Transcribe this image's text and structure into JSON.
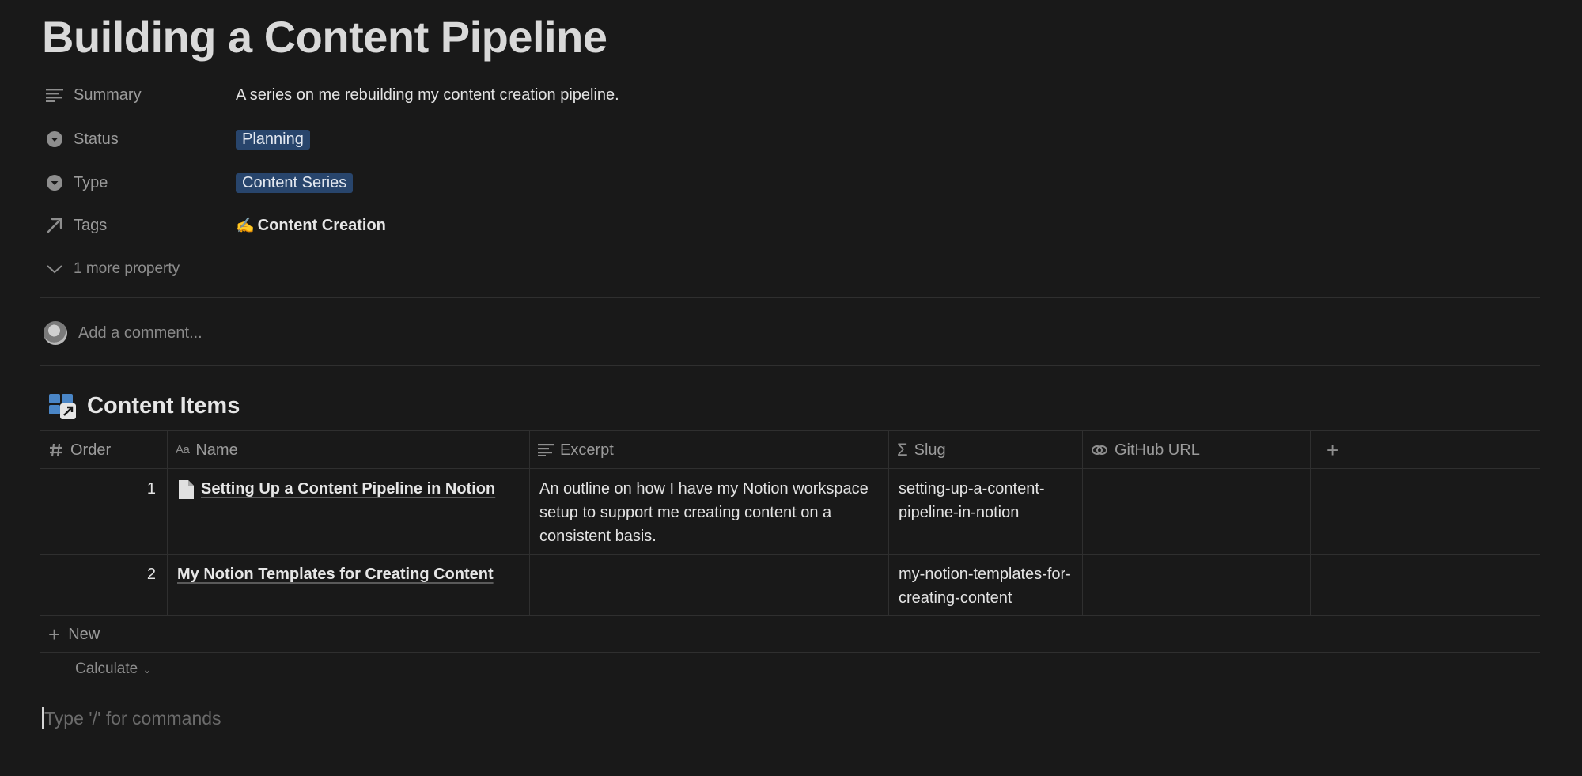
{
  "page": {
    "title": "Building a Content Pipeline"
  },
  "properties": [
    {
      "icon": "text-lines-icon",
      "label": "Summary",
      "value": "A series on me rebuilding my content creation pipeline."
    },
    {
      "icon": "select-icon",
      "label": "Status",
      "value": "Planning"
    },
    {
      "icon": "select-icon",
      "label": "Type",
      "value": "Content Series"
    },
    {
      "icon": "relation-arrow-icon",
      "label": "Tags",
      "value": "Content Creation",
      "emoji": "✍️"
    }
  ],
  "more_property": "1 more property",
  "comment": {
    "placeholder": "Add a comment..."
  },
  "database": {
    "title": "Content Items",
    "columns": [
      {
        "icon": "number-icon",
        "label": "Order"
      },
      {
        "icon": "title-icon",
        "label": "Name"
      },
      {
        "icon": "text-lines-icon",
        "label": "Excerpt"
      },
      {
        "icon": "formula-icon",
        "label": "Slug"
      },
      {
        "icon": "url-link-icon",
        "label": "GitHub URL"
      }
    ],
    "add_column": "+",
    "rows": [
      {
        "order": "1",
        "name": "Setting Up a Content Pipeline in Notion",
        "excerpt": "An outline on how I have my Notion workspace setup to support me creating content on a consistent basis.",
        "slug": "setting-up-a-content-pipeline-in-notion",
        "github_url": ""
      },
      {
        "order": "2",
        "name": "My Notion Templates for Creating Content",
        "excerpt": "",
        "slug": "my-notion-templates-for-creating-content",
        "github_url": ""
      }
    ],
    "new_label": "New",
    "calculate_label": "Calculate"
  },
  "editor": {
    "placeholder": "Type '/' for commands"
  },
  "colors": {
    "background": "#191919",
    "tag_background": "#28456c",
    "divider": "#2f2f2f"
  }
}
